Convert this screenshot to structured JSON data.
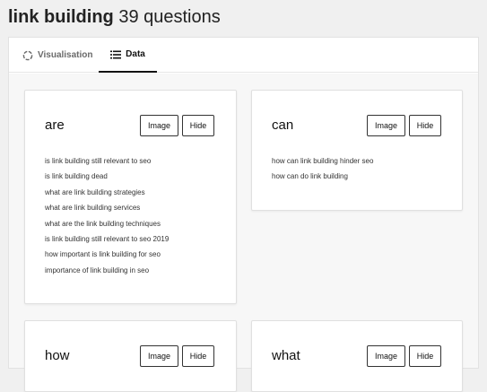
{
  "header": {
    "keyword": "link building",
    "count_label": "39 questions"
  },
  "tabs": [
    {
      "label": "Visualisation",
      "icon": "visualisation-icon",
      "active": false
    },
    {
      "label": "Data",
      "icon": "list-icon",
      "active": true
    }
  ],
  "buttons": {
    "image_label": "Image",
    "hide_label": "Hide"
  },
  "cards": [
    {
      "title": "are",
      "questions": [
        "is link building still relevant to seo",
        "is link building dead",
        "what are link building strategies",
        "what are link building services",
        "what are the link building techniques",
        "is link building still relevant to seo 2019",
        "how important is link building for seo",
        "importance of link building in seo"
      ]
    },
    {
      "title": "can",
      "questions": [
        "how can link building hinder seo",
        "how can do link building"
      ]
    },
    {
      "title": "how",
      "questions": []
    },
    {
      "title": "what",
      "questions": []
    }
  ]
}
